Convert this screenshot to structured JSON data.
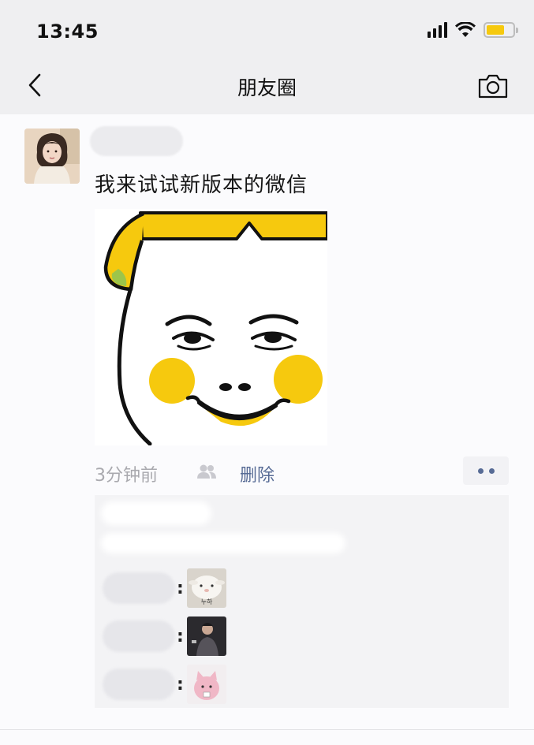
{
  "status_bar": {
    "time": "13:45"
  },
  "nav": {
    "title": "朋友圈"
  },
  "post": {
    "text": "我来试试新版本的微信",
    "time": "3分钟前",
    "delete_label": "删除"
  },
  "comments": {
    "sticker_1_text": "누하"
  },
  "colors": {
    "link": "#576b95",
    "meme_yellow": "#f6c90e"
  },
  "icons": [
    "back-arrow-icon",
    "camera-icon",
    "friends-icon",
    "more-dots-icon",
    "signal-icon",
    "wifi-icon",
    "battery-icon"
  ]
}
